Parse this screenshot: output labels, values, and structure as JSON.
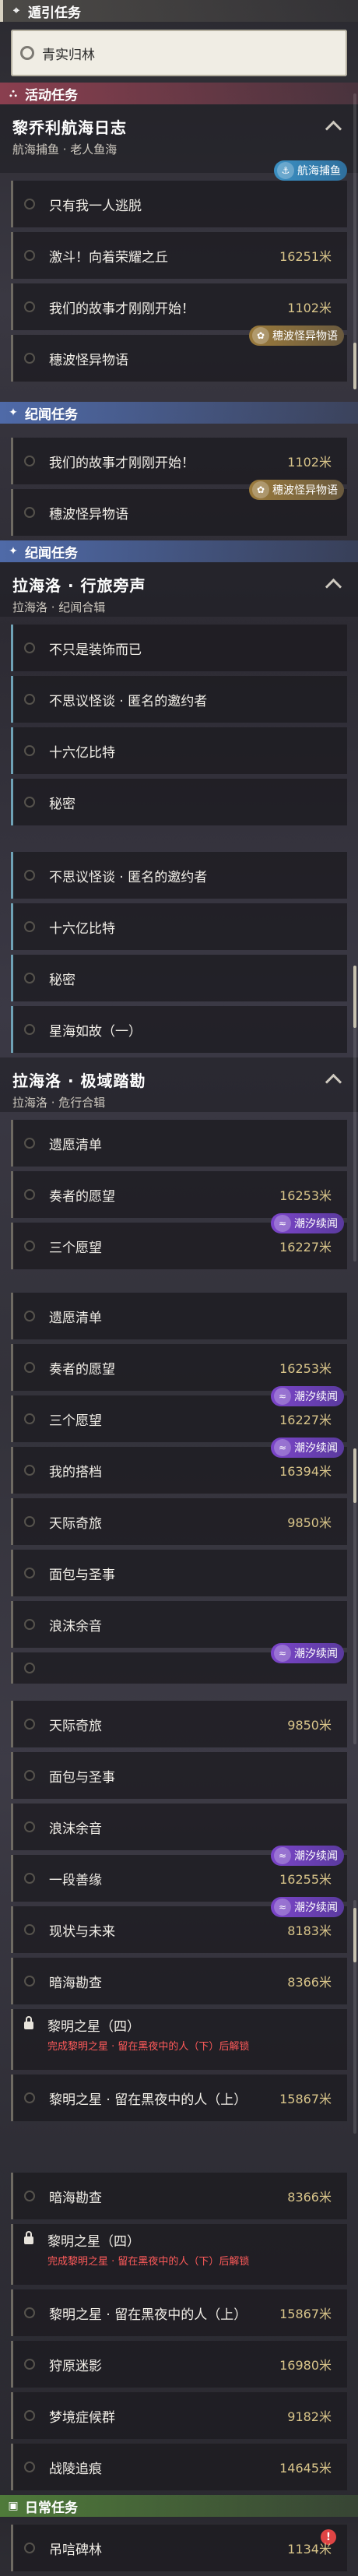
{
  "sections": {
    "guide": "遁引任务",
    "activity": "活动任务",
    "record": "纪闻任务",
    "daily": "日常任务"
  },
  "guide_task": "青实归林",
  "groups": {
    "navigation_log": {
      "title": "黎乔利航海日志",
      "subtitle": "航海捕鱼 · 老人鱼海"
    },
    "lahailuo_journey": {
      "title": "拉海洛 · 行旅旁声",
      "subtitle": "拉海洛 · 纪闻合辑"
    },
    "lahailuo_polar": {
      "title": "拉海洛 · 极域踏勘",
      "subtitle": "拉海洛 · 危行合辑"
    }
  },
  "tasks": {
    "escape_alone": "只有我一人逃脱",
    "glory_hill": "激斗！向着荣耀之丘",
    "glory_hill_dist": "16251米",
    "story_start": "我们的故事才刚刚开始！",
    "story_start_dist": "1102米",
    "wave_story": "穗波怪异物语",
    "not_decor": "不只是装饰而已",
    "strange_invite": "不思议怪谈 · 匿名的邀约者",
    "sixteen_billion": "十六亿比特",
    "secret": "秘密",
    "star_sea": "星海如故（一）",
    "wish_list": "遗愿清单",
    "player_wish": "奏者的愿望",
    "player_wish_dist": "16253米",
    "three_wishes": "三个愿望",
    "three_wishes_dist": "16227米",
    "my_partner": "我的搭档",
    "my_partner_dist": "16394米",
    "sky_journey": "天际奇旅",
    "sky_journey_dist": "9850米",
    "bread_king": "面包与圣事",
    "foam_echo": "浪沫余音",
    "fate_ties": "一段善缘",
    "fate_ties_dist": "16255米",
    "present_future": "现状与未来",
    "present_future_dist": "8183米",
    "dark_sea": "暗海勘查",
    "dark_sea_dist": "8366米",
    "dawn_star_four": "黎明之星（四）",
    "dawn_star_four_note": "完成黎明之星 · 留在黑夜中的人（下）后解锁",
    "dawn_star_up": "黎明之星 · 留在黑夜中的人（上）",
    "dawn_star_up_dist": "15867米",
    "hunting_path": "狩原迷影",
    "hunting_path_dist": "16980米",
    "dream_birds": "梦境症候群",
    "dream_birds_dist": "9182米",
    "battle_trace": "战陵追痕",
    "battle_trace_dist": "14645米",
    "hanging_forest": "吊唁碑林",
    "hanging_forest_dist": "1134米"
  },
  "badges": {
    "fishing": "航海捕鱼",
    "wave": "穗波怪异物语",
    "tide": "潮汐续闻"
  },
  "colors": {
    "activity": "#8a3f4f",
    "record": "#4f6aa8",
    "daily": "#4f7a3a",
    "distance": "#d9c58a",
    "lock_note": "#ff5a5a"
  }
}
